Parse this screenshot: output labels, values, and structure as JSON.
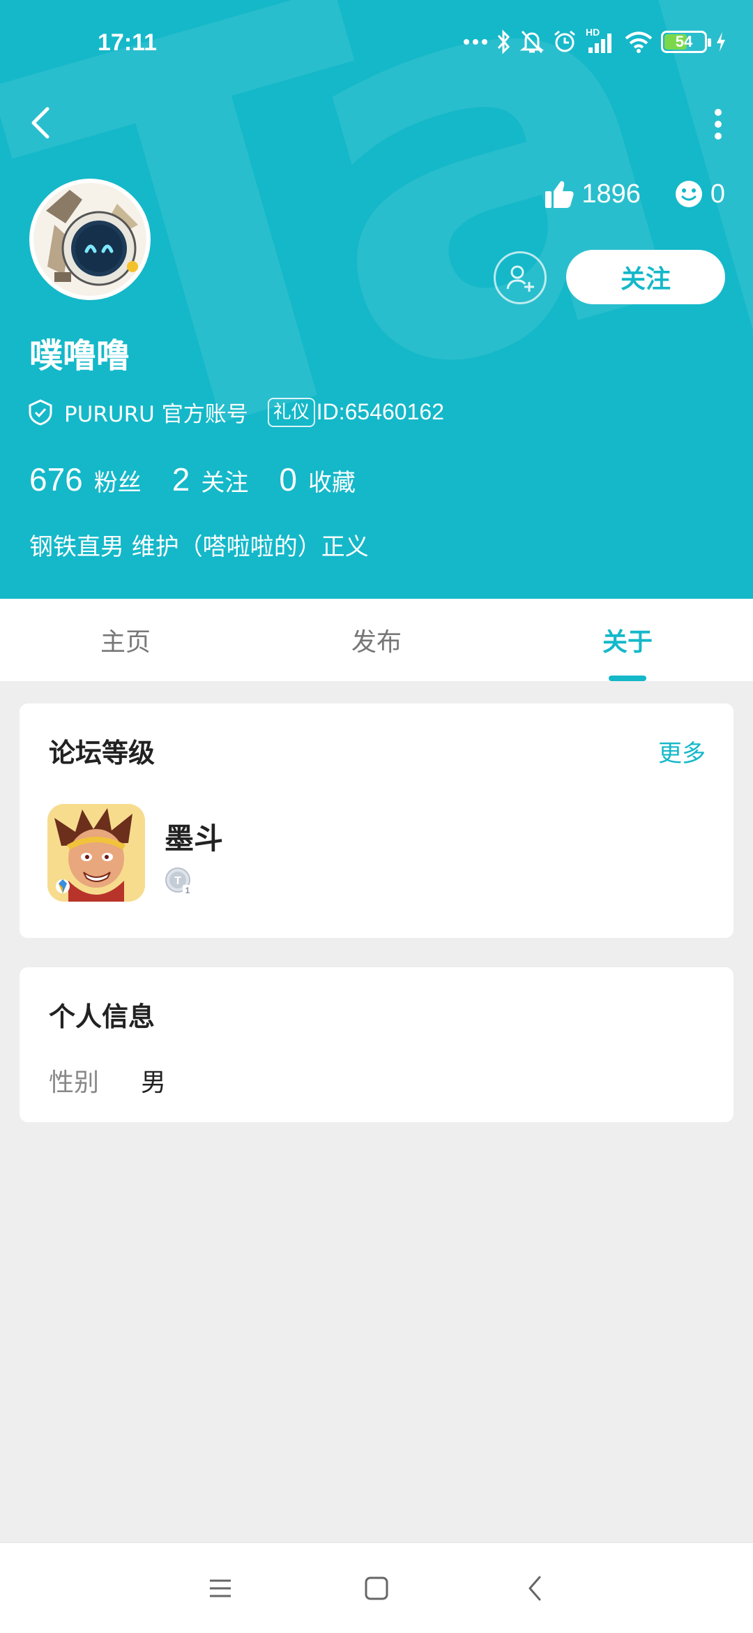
{
  "status_bar": {
    "time": "17:11",
    "network": "HD",
    "battery": "54"
  },
  "header": {
    "watermark": "TapTap",
    "likes": "1896",
    "smiles": "0",
    "follow_label": "关注",
    "username": "噗噜噜",
    "verify_text": "PURURU 官方账号",
    "tag": "礼仪",
    "user_id": "ID:65460162",
    "counts": [
      {
        "num": "676",
        "label": "粉丝"
      },
      {
        "num": "2",
        "label": "关注"
      },
      {
        "num": "0",
        "label": "收藏"
      }
    ],
    "bio": "钢铁直男 维护（嗒啦啦的）正义"
  },
  "tabs": [
    {
      "label": "主页",
      "active": false
    },
    {
      "label": "发布",
      "active": false
    },
    {
      "label": "关于",
      "active": true
    }
  ],
  "forum_card": {
    "title": "论坛等级",
    "more": "更多",
    "game_name": "墨斗",
    "level_badge_letter": "T",
    "level_badge_number": "1"
  },
  "info_card": {
    "title": "个人信息",
    "gender_label": "性别",
    "gender_value": "男"
  },
  "colors": {
    "accent": "#14b8c9",
    "background": "#eeeeee"
  }
}
